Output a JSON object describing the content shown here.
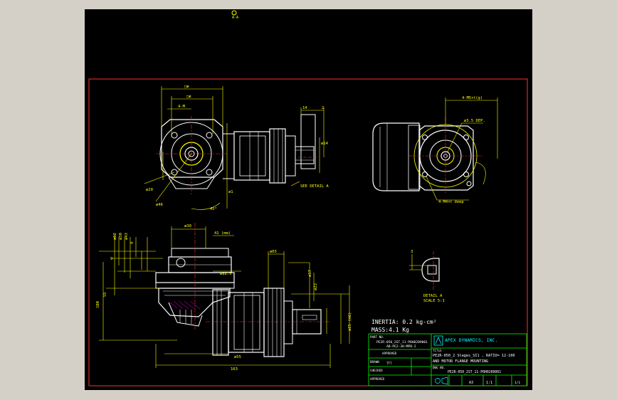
{
  "colors": {
    "background": "#000000",
    "frame": "#ff3030",
    "outline": "#ffffff",
    "dimension": "#ffff00",
    "table": "#00ff00",
    "hatch": "#ff00ff",
    "centerline": "#ff3030"
  },
  "top_mark": "A-A",
  "views": {
    "front_left": {
      "dims": [
        "□ø",
        "□ø",
        "4-M",
        "ø20",
        "ø46",
        "45°",
        "14",
        "2",
        "SEE DETAIL A",
        "ø14",
        "ø1"
      ]
    },
    "front_right": {
      "dims": [
        "4-M5×ℓ(g)",
        "ø3.5 DEP.",
        "4-M4×ℓ deep"
      ]
    },
    "side_section": {
      "dims": [
        "ø30",
        "41 (mm)",
        "ø62",
        "ø30",
        "ø43",
        "ø82.5",
        "ø65",
        "ø17",
        "ø23",
        "4",
        "9",
        "100",
        "55",
        "ø55",
        "ø25 (m6)",
        "163"
      ]
    },
    "detail": {
      "dims": [
        "3",
        "DETAIL A",
        "SCALE 5:1"
      ]
    }
  },
  "notes": {
    "inertia": "INERTIA: 0.2 kg-cm²",
    "mass": "MASS:4.1 Kg"
  },
  "title_block": {
    "part_no_label": "PART NO.",
    "part_no_1": "PE2R-050_2ST_11-P0H0209001",
    "part_no_2": "AB-PE2-3H-MPB-I",
    "approved_label": "APPROVED",
    "drawn_label": "DRAWN",
    "drawn_value": "TTT",
    "checked_label": "CHECKED",
    "approved2_label": "APPROVED",
    "company": "APEX DYNAMICS, INC.",
    "title_label": "TITLE",
    "title_line1": "PE2R-050_2 Stages_SI1 , RATIO= 12-100",
    "title_line2": "AND MOTOR FLANGE  MOUNTING",
    "dwg_label": "DWG NO.",
    "dwg_no": "PE2R-050_2ST_11-P0H0209001",
    "size": "A3",
    "scale": "1:1",
    "sheet": "1/1"
  }
}
